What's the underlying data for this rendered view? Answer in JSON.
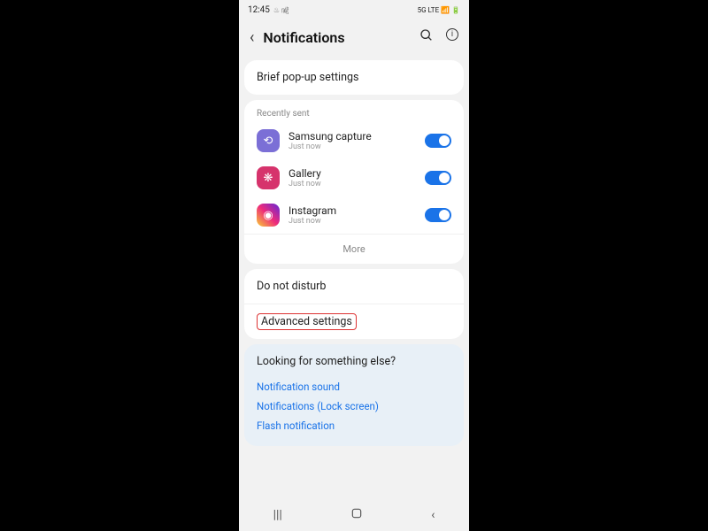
{
  "status": {
    "time": "12:45",
    "indicators_left": "♨︎ ㎯",
    "indicators_right": "5G LTE 📶 🔋"
  },
  "header": {
    "title": "Notifications"
  },
  "brief": {
    "label": "Brief pop-up settings"
  },
  "recently_sent": {
    "header": "Recently sent",
    "apps": [
      {
        "name": "Samsung capture",
        "sub": "Just now",
        "glyph": "⟲"
      },
      {
        "name": "Gallery",
        "sub": "Just now",
        "glyph": "❋"
      },
      {
        "name": "Instagram",
        "sub": "Just now",
        "glyph": "◉"
      }
    ],
    "more": "More"
  },
  "settings": {
    "dnd": "Do not disturb",
    "advanced": "Advanced settings"
  },
  "suggest": {
    "title": "Looking for something else?",
    "links": [
      "Notification sound",
      "Notifications (Lock screen)",
      "Flash notification"
    ]
  }
}
